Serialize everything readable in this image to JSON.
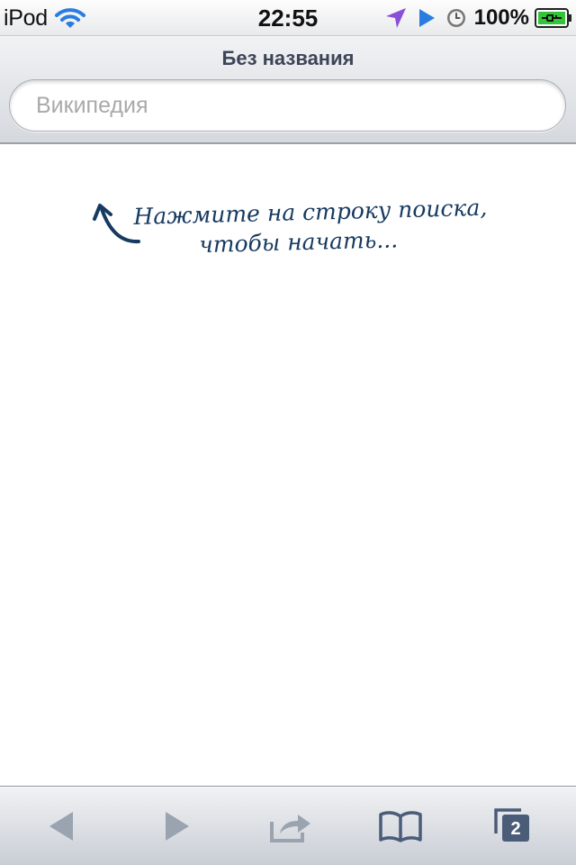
{
  "status_bar": {
    "carrier": "iPod",
    "time": "22:55",
    "battery_percent": "100%",
    "icons": [
      "wifi-icon",
      "location-arrow-icon",
      "play-icon",
      "clock-icon",
      "battery-charging-icon"
    ]
  },
  "header": {
    "title": "Без названия",
    "search": {
      "placeholder": "Википедия",
      "value": ""
    }
  },
  "main": {
    "hint_line1": "Нажмите на строку поиска,",
    "hint_line2": "чтобы начать...",
    "hint_icon": "curved-arrow-icon"
  },
  "toolbar": {
    "items": [
      {
        "name": "back",
        "icon": "back-arrow-icon",
        "enabled": false
      },
      {
        "name": "forward",
        "icon": "forward-arrow-icon",
        "enabled": false
      },
      {
        "name": "share",
        "icon": "share-icon",
        "enabled": false
      },
      {
        "name": "bookmarks",
        "icon": "book-icon",
        "enabled": true
      },
      {
        "name": "tabs",
        "icon": "tabs-icon",
        "enabled": true
      }
    ],
    "tab_count": "2"
  },
  "colors": {
    "hint_text": "#163a60",
    "toolbar_icon_active": "#4a5c78",
    "toolbar_icon_disabled": "#9aa3b0",
    "battery_green": "#34c43a"
  }
}
